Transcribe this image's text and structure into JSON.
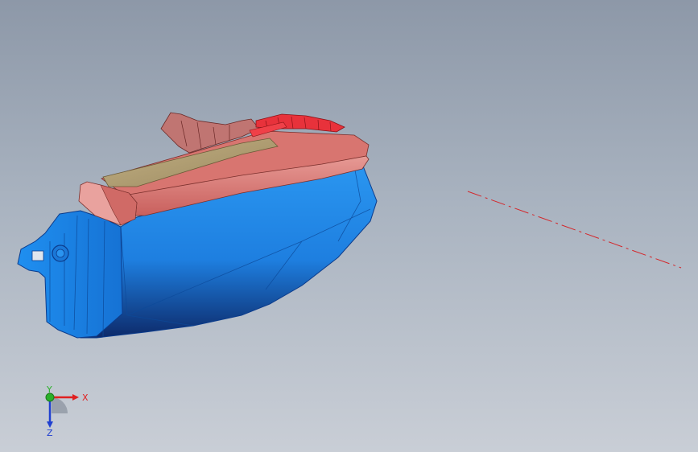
{
  "viewport": {
    "model": "3d-part-assembly",
    "colors": {
      "background_top": "#8d98a8",
      "background_bottom": "#c9ced6",
      "body": "#1e8be6",
      "body_dark": "#1460b8",
      "cover": "#d67874",
      "cover_light": "#e9a29e",
      "tray": "#b09f76",
      "highlight": "#e8323b",
      "centerline": "#d4262a"
    }
  },
  "triad": {
    "x_label": "X",
    "y_label": "Y",
    "z_label": "Z",
    "x_color": "#e02020",
    "y_color": "#2ab02a",
    "z_color": "#2040d0"
  }
}
